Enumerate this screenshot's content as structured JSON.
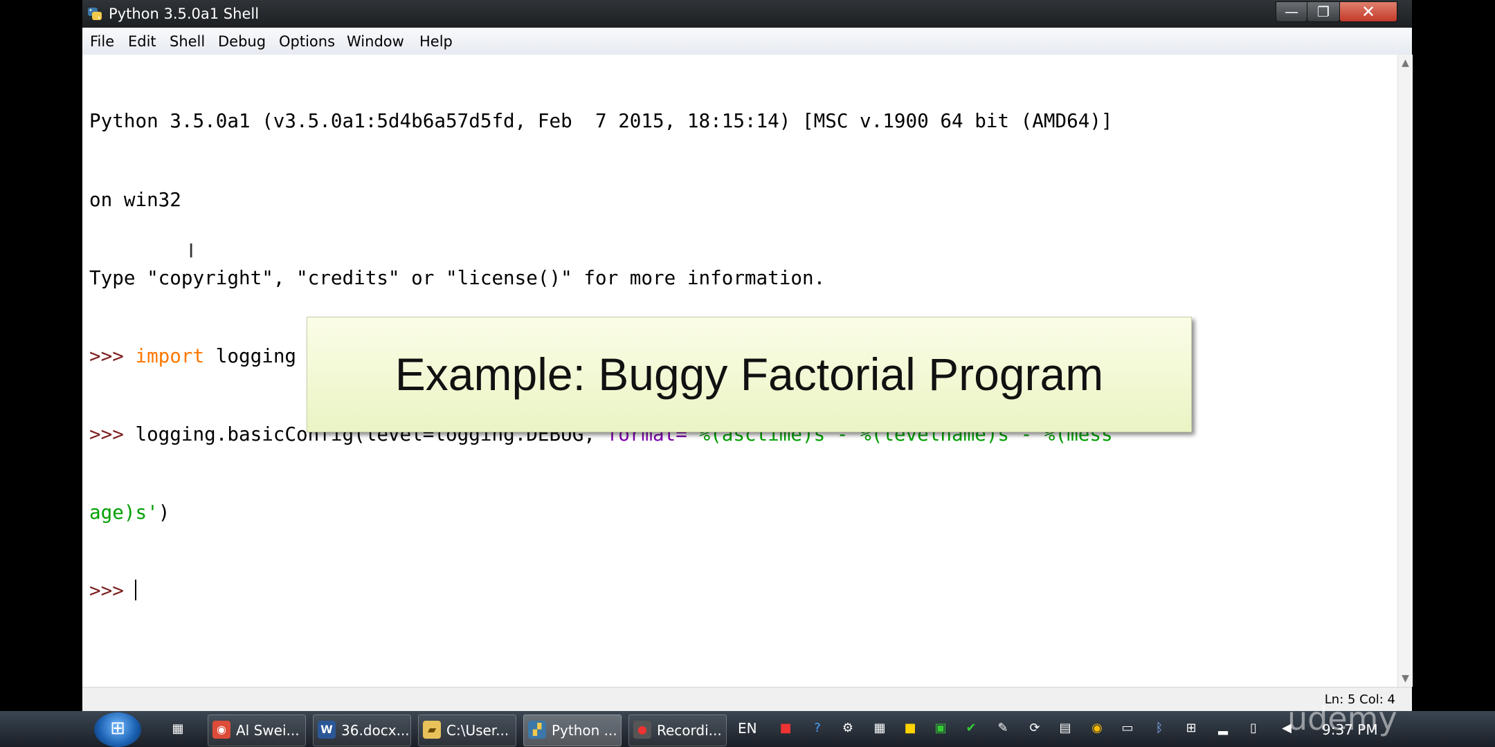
{
  "window": {
    "title": "Python 3.5.0a1 Shell",
    "controls": {
      "minimize": "—",
      "maximize": "❐",
      "close": "✕"
    }
  },
  "menu": [
    "File",
    "Edit",
    "Shell",
    "Debug",
    "Options",
    "Window",
    "Help"
  ],
  "shell": {
    "line1": "Python 3.5.0a1 (v3.5.0a1:5d4b6a57d5fd, Feb  7 2015, 18:15:14) [MSC v.1900 64 bit (AMD64)]",
    "line2": "on win32",
    "line3": "Type \"copyright\", \"credits\" or \"license()\" for more information.",
    "prompt": ">>> ",
    "cmd1_keyword": "import",
    "cmd1_rest": " logging",
    "cmd2_call": "logging.basicConfig(level=logging.DEBUG, ",
    "cmd2_kwarg": "format=",
    "cmd2_str_part1": "'%(asctime)s - %(levelname)s - %(mess",
    "cmd2_str_part2": "age)s'",
    "cmd2_close": ")"
  },
  "status": {
    "position": "Ln: 5 Col: 4"
  },
  "banner": {
    "text": "Example: Buggy Factorial Program"
  },
  "taskbar": {
    "windows": [
      {
        "label": "Al Swei...",
        "icon": "chrome-icon"
      },
      {
        "label": "36.docx...",
        "icon": "word-icon"
      },
      {
        "label": "C:\\User...",
        "icon": "folder-icon"
      },
      {
        "label": "Python ...",
        "icon": "python-icon"
      },
      {
        "label": "Recordi...",
        "icon": "recorder-icon"
      }
    ],
    "language": "EN",
    "clock": "9:37 PM"
  },
  "watermark": "udemy",
  "colors": {
    "prompt": "#7b1e1e",
    "keyword": "#ff7700",
    "kwarg": "#7f00aa",
    "string": "#00a000"
  }
}
